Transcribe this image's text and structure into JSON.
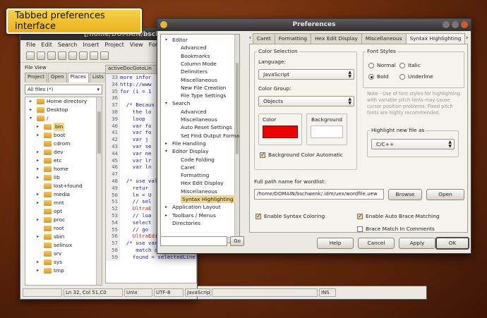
{
  "callout": {
    "text": "Tabbed preferences interface"
  },
  "editor": {
    "title": "[/home/DOMAIN/bschw",
    "menu": [
      "File",
      "Edit",
      "Search",
      "Insert",
      "Project",
      "View",
      "For"
    ],
    "file_view": {
      "header": "File View",
      "tabs": [
        "Project",
        "Open",
        "Places",
        "Lists"
      ],
      "active_tab": "Places",
      "filter": "All files (*)",
      "tree": [
        {
          "label": "Home directory",
          "level": 0,
          "arrow": "▸"
        },
        {
          "label": "Desktop",
          "level": 0,
          "arrow": "▸"
        },
        {
          "label": "/",
          "level": 0,
          "arrow": "▾"
        },
        {
          "label": "bin",
          "level": 1,
          "arrow": "▸",
          "selected": true
        },
        {
          "label": "boot",
          "level": 1,
          "arrow": "▸"
        },
        {
          "label": "cdrom",
          "level": 1,
          "arrow": ""
        },
        {
          "label": "dev",
          "level": 1,
          "arrow": "▸"
        },
        {
          "label": "etc",
          "level": 1,
          "arrow": "▸"
        },
        {
          "label": "home",
          "level": 1,
          "arrow": "▸"
        },
        {
          "label": "lib",
          "level": 1,
          "arrow": "▸"
        },
        {
          "label": "lost+found",
          "level": 1,
          "arrow": ""
        },
        {
          "label": "media",
          "level": 1,
          "arrow": "▸"
        },
        {
          "label": "mnt",
          "level": 1,
          "arrow": "▸"
        },
        {
          "label": "opt",
          "level": 1,
          "arrow": ""
        },
        {
          "label": "proc",
          "level": 1,
          "arrow": "▸"
        },
        {
          "label": "root",
          "level": 1,
          "arrow": ""
        },
        {
          "label": "sbin",
          "level": 1,
          "arrow": "▸"
        },
        {
          "label": "selinux",
          "level": 1,
          "arrow": ""
        },
        {
          "label": "srv",
          "level": 1,
          "arrow": ""
        },
        {
          "label": "sys",
          "level": 1,
          "arrow": "▸"
        },
        {
          "label": "tmp",
          "level": 1,
          "arrow": "▸"
        }
      ]
    },
    "code_tab": "activeDocGotoLin",
    "code_lines": [
      {
        "n": "33",
        "text": "more infor",
        "red": false
      },
      {
        "n": "34",
        "text": "http://www",
        "red": false
      },
      {
        "n": "35",
        "text": "for (i = 1",
        "red": false
      },
      {
        "n": "36",
        "text": "",
        "red": false
      },
      {
        "n": "37",
        "text": "  /* Becaus",
        "red": false
      },
      {
        "n": "38",
        "text": "    the lo",
        "red": false
      },
      {
        "n": "39",
        "text": "    loop",
        "red": false
      },
      {
        "n": "40",
        "text": "    var fo",
        "red": false
      },
      {
        "n": "41",
        "text": "    var fo",
        "red": false
      },
      {
        "n": "42",
        "text": "    var j",
        "red": false
      },
      {
        "n": "43",
        "text": "    var se",
        "red": false
      },
      {
        "n": "44",
        "text": "    var ne",
        "red": false
      },
      {
        "n": "45",
        "text": "    var lr",
        "red": false
      },
      {
        "n": "46",
        "text": "    var ln",
        "red": false
      },
      {
        "n": "47",
        "text": "",
        "red": false
      },
      {
        "n": "48",
        "text": "  /* use val",
        "red": false
      },
      {
        "n": "49",
        "text": "    retur",
        "red": false
      },
      {
        "n": "50",
        "text": "    ln = U",
        "red": false
      },
      {
        "n": "51",
        "text": "    // sel",
        "red": false
      },
      {
        "n": "52",
        "text": "    UltraE",
        "red": true
      },
      {
        "n": "53",
        "text": "    // loa",
        "red": false
      },
      {
        "n": "54",
        "text": "    select",
        "red": false
      },
      {
        "n": "55",
        "text": "    // go",
        "red": false
      },
      {
        "n": "56",
        "text": "    UltraEdit.activeDocument.gotoLine(ln, 1);",
        "red": true
      },
      {
        "n": "57",
        "text": "  /* use variable \"found\" to store whether or not we were able to",
        "red": false
      },
      {
        "n": "58",
        "text": "     match our regex in the selection */",
        "red": false
      },
      {
        "n": "59",
        "text": "    found = selectedLine.match(tregex);",
        "red": false
      }
    ],
    "status": [
      "Ln 32, Col 51,C0",
      "Unix",
      "UTF-8",
      "JavaScrip",
      "",
      "INS"
    ]
  },
  "dialog": {
    "title": "Preferences",
    "nav": [
      {
        "label": "Editor",
        "depth": 0,
        "arrow": "▾"
      },
      {
        "label": "Advanced",
        "depth": 1
      },
      {
        "label": "Bookmarks",
        "depth": 1
      },
      {
        "label": "Column Mode",
        "depth": 1
      },
      {
        "label": "Delimiters",
        "depth": 1
      },
      {
        "label": "Miscellaneous",
        "depth": 1
      },
      {
        "label": "New File Creation",
        "depth": 1
      },
      {
        "label": "File Type Settings",
        "depth": 1
      },
      {
        "label": "Search",
        "depth": 0,
        "arrow": "▾"
      },
      {
        "label": "Advanced",
        "depth": 1
      },
      {
        "label": "Miscellaneous",
        "depth": 1
      },
      {
        "label": "Auto Reset Settings",
        "depth": 1
      },
      {
        "label": "Set Find Output Forma",
        "depth": 1
      },
      {
        "label": "File Handling",
        "depth": 0,
        "arrow": "▸"
      },
      {
        "label": "Editor Display",
        "depth": 0,
        "arrow": "▾"
      },
      {
        "label": "Code Folding",
        "depth": 1
      },
      {
        "label": "Caret",
        "depth": 1
      },
      {
        "label": "Formatting",
        "depth": 1
      },
      {
        "label": "Hex Edit Display",
        "depth": 1
      },
      {
        "label": "Miscellaneous",
        "depth": 1
      },
      {
        "label": "Syntax Highlighting",
        "depth": 1,
        "selected": true
      },
      {
        "label": "Application Layout",
        "depth": 0,
        "arrow": "▸"
      },
      {
        "label": "Toolbars / Menus",
        "depth": 0,
        "arrow": "▸"
      },
      {
        "label": "Directories",
        "depth": 0,
        "arrow": ""
      }
    ],
    "go_label": "Go",
    "tabs": [
      "Caret",
      "Formatting",
      "Hex Edit Display",
      "Miscellaneous",
      "Syntax Highlighting"
    ],
    "active_tab": "Syntax Highlighting",
    "color_selection": {
      "title": "Color Selection",
      "language_label": "Language:",
      "language_value": "JavaScript",
      "group_label": "Color Group:",
      "group_value": "Objects",
      "color_label": "Color",
      "background_label": "Background",
      "color_hex": "#ee0000",
      "bg_auto_label": "Background Color Automatic",
      "bg_auto_checked": true
    },
    "font_styles": {
      "title": "Font Styles",
      "options": [
        "Normal",
        "Italic",
        "Bold",
        "Underline"
      ],
      "selected": "Bold",
      "note": "Note - Use of font styles for highlighting with variable pitch fonts may cause cursor position problems.  Fixed pitch fonts are highly recommended."
    },
    "highlight_new": {
      "title": "Highlight new file as",
      "value": "C/C++"
    },
    "wordlist": {
      "label": "Full path name for wordlist:",
      "value": "/home/DOMAIN/bschwenk/.idm/uex/wordfile.uew",
      "browse": "Browse",
      "open": "Open"
    },
    "options": [
      {
        "label": "Enable Syntax Coloring",
        "checked": true
      },
      {
        "label": "Enable Auto Brace Matching",
        "checked": true
      },
      {
        "label": "Brace Match In Comments",
        "checked": false
      }
    ],
    "buttons": {
      "help": "Help",
      "cancel": "Cancel",
      "apply": "Apply",
      "ok": "OK"
    }
  }
}
